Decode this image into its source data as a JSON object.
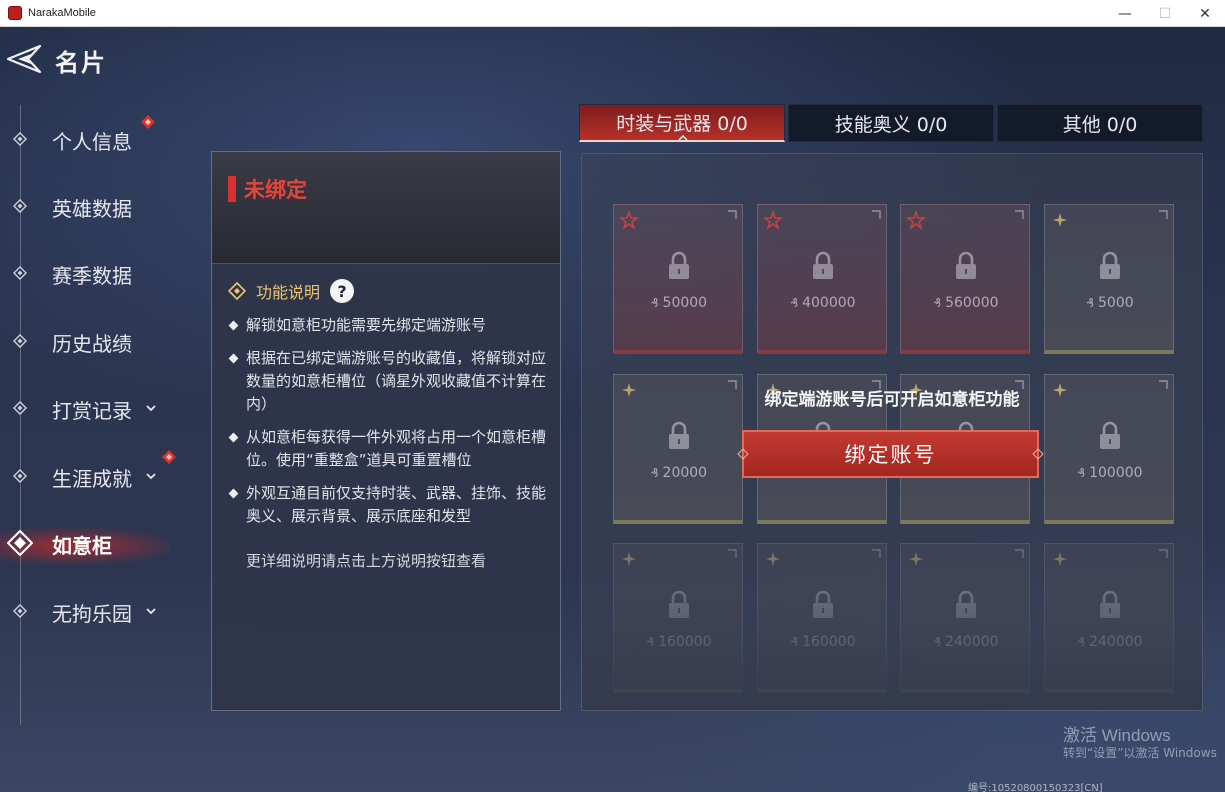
{
  "window": {
    "title": "NarakaMobile",
    "minimize": "—",
    "maximize": "☐",
    "close": "✕"
  },
  "header": {
    "title": "名片"
  },
  "sidebar": {
    "items": [
      {
        "label": "个人信息",
        "badge": true,
        "chevron": false,
        "active": false
      },
      {
        "label": "英雄数据",
        "badge": false,
        "chevron": false,
        "active": false
      },
      {
        "label": "赛季数据",
        "badge": false,
        "chevron": false,
        "active": false
      },
      {
        "label": "历史战绩",
        "badge": false,
        "chevron": false,
        "active": false
      },
      {
        "label": "打赏记录",
        "badge": false,
        "chevron": true,
        "active": false
      },
      {
        "label": "生涯成就",
        "badge": true,
        "chevron": true,
        "active": false
      },
      {
        "label": "如意柜",
        "badge": false,
        "chevron": false,
        "active": true
      },
      {
        "label": "无拘乐园",
        "badge": false,
        "chevron": true,
        "active": false
      }
    ]
  },
  "info_panel": {
    "status": "未绑定",
    "func_title": "功能说明",
    "help_label": "?",
    "bullets": [
      "解锁如意柜功能需要先绑定端游账号",
      "根据在已绑定端游账号的收藏值，将解锁对应数量的如意柜槽位（谪星外观收藏值不计算在内）",
      "从如意柜每获得一件外观将占用一个如意柜槽位。使用“重整盒”道具可重置槽位",
      "外观互通目前仅支持时装、武器、挂饰、技能奥义、展示背景、展示底座和发型"
    ],
    "more_info": "更详细说明请点击上方说明按钮查看"
  },
  "tabs": [
    {
      "label": "时装与武器 0/0",
      "active": true
    },
    {
      "label": "技能奥义 0/0",
      "active": false
    },
    {
      "label": "其他 0/0",
      "active": false
    }
  ],
  "cards": [
    {
      "price": "50000",
      "tier": "red"
    },
    {
      "price": "400000",
      "tier": "red"
    },
    {
      "price": "560000",
      "tier": "red"
    },
    {
      "price": "5000",
      "tier": "gold"
    },
    {
      "price": "20000",
      "tier": "gold"
    },
    {
      "price": "",
      "tier": "gold"
    },
    {
      "price": "",
      "tier": "gold"
    },
    {
      "price": "100000",
      "tier": "gold"
    },
    {
      "price": "160000",
      "tier": "gold"
    },
    {
      "price": "160000",
      "tier": "gold"
    },
    {
      "price": "240000",
      "tier": "gold"
    },
    {
      "price": "240000",
      "tier": "gold"
    }
  ],
  "overlay": {
    "message": "绑定端游账号后可开启如意柜功能",
    "bind_button": "绑定账号"
  },
  "watermark": {
    "line1": "激活 Windows",
    "line2": "转到“设置”以激活 Windows",
    "build": "编号:10520800150323[CN]"
  },
  "colors": {
    "accent_red": "#c23a32",
    "status_red": "#e8443a",
    "func_gold": "#f0c46a",
    "tier_red": "#963a3a",
    "tier_gold": "#968c5f"
  }
}
